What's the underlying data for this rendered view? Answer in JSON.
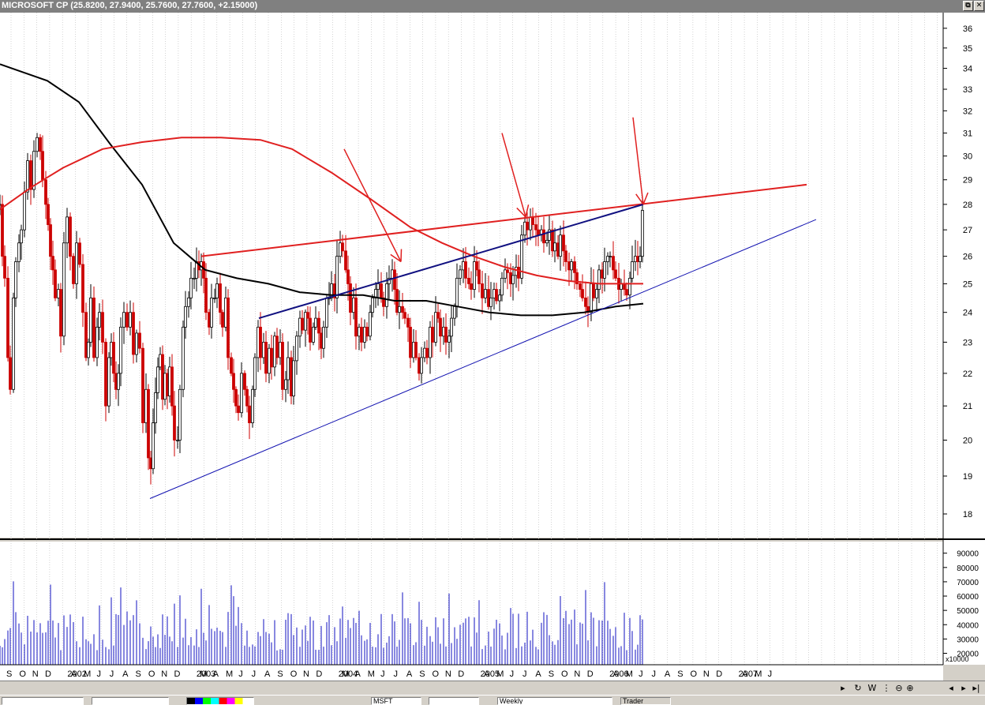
{
  "window": {
    "title": "MICROSOFT CP (25.8200, 27.9400, 25.7600, 27.7600, +2.15000)",
    "restore_label": "⧉",
    "close_label": "✕"
  },
  "colors": {
    "background": "#ffffff",
    "frame": "#d4d0c8",
    "candle": "#000000",
    "down_candle": "#cc0000",
    "ma_black": "#000000",
    "ma_red": "#e02020",
    "trend_blue": "#1010b0",
    "trend_red": "#e02020",
    "volume": "#1010c0"
  },
  "chart_data": {
    "type": "candlestick",
    "price_axis": {
      "scale": "log",
      "ylim": [
        17.5,
        36.4
      ],
      "ticks": [
        18,
        19,
        20,
        21,
        22,
        23,
        24,
        25,
        26,
        27,
        28,
        29,
        30,
        31,
        32,
        33,
        34,
        35,
        36
      ]
    },
    "volume_axis": {
      "ylim": [
        12000,
        97000
      ],
      "ticks": [
        20000,
        30000,
        40000,
        50000,
        60000,
        70000,
        80000,
        90000
      ],
      "tick_labels": [
        "20000",
        "30000",
        "40000",
        "50000",
        "60000",
        "70000",
        "80000",
        "90000"
      ],
      "unit_label": "x10000"
    },
    "x_axis": {
      "labels": [
        "S",
        "O",
        "N",
        "D",
        "2002",
        "A",
        "M",
        "J",
        "J",
        "A",
        "S",
        "O",
        "N",
        "D",
        "2003",
        "M",
        "A",
        "M",
        "J",
        "J",
        "A",
        "S",
        "O",
        "N",
        "D",
        "2004",
        "M",
        "A",
        "M",
        "J",
        "J",
        "A",
        "S",
        "O",
        "N",
        "D",
        "2005",
        "A",
        "M",
        "J",
        "J",
        "A",
        "S",
        "O",
        "N",
        "D",
        "2006",
        "A",
        "M",
        "J",
        "J",
        "A",
        "S",
        "O",
        "N",
        "D",
        "2007",
        "A",
        "M",
        "J"
      ]
    },
    "price_anchors": [
      [
        0,
        28
      ],
      [
        3,
        26
      ],
      [
        6,
        25.2
      ],
      [
        10,
        22.5
      ],
      [
        13,
        21.5
      ],
      [
        17,
        24.5
      ],
      [
        20,
        25.8
      ],
      [
        24,
        26.5
      ],
      [
        27,
        27
      ],
      [
        31,
        28.5
      ],
      [
        35,
        29.8
      ],
      [
        39,
        28.6
      ],
      [
        43,
        30.2
      ],
      [
        47,
        30.8
      ],
      [
        51,
        30.2
      ],
      [
        54,
        29
      ],
      [
        58,
        28
      ],
      [
        61,
        27.2
      ],
      [
        64,
        26
      ],
      [
        67,
        25.5
      ],
      [
        70,
        24.5
      ],
      [
        74,
        24.8
      ],
      [
        77,
        23.2
      ],
      [
        81,
        26.5
      ],
      [
        85,
        27.5
      ],
      [
        89,
        26
      ],
      [
        93,
        25
      ],
      [
        97,
        26.5
      ],
      [
        101,
        25.7
      ],
      [
        105,
        24
      ],
      [
        109,
        22.5
      ],
      [
        112,
        23
      ],
      [
        115,
        24.5
      ],
      [
        119,
        22.5
      ],
      [
        123,
        23.5
      ],
      [
        126,
        24
      ],
      [
        130,
        23
      ],
      [
        134,
        21
      ],
      [
        138,
        22.5
      ],
      [
        141,
        23
      ],
      [
        144,
        22
      ],
      [
        147,
        21.5
      ],
      [
        150,
        22
      ],
      [
        153,
        23.5
      ],
      [
        157,
        24
      ],
      [
        161,
        23.5
      ],
      [
        165,
        24
      ],
      [
        169,
        22.6
      ],
      [
        173,
        23.3
      ],
      [
        177,
        22.8
      ],
      [
        181,
        20.5
      ],
      [
        185,
        21.5
      ],
      [
        188,
        19.5
      ],
      [
        191,
        19.2
      ],
      [
        194,
        20.5
      ],
      [
        197,
        21.4
      ],
      [
        200,
        22.2
      ],
      [
        203,
        22.6
      ],
      [
        206,
        21.2
      ],
      [
        209,
        22
      ],
      [
        212,
        21.3
      ],
      [
        215,
        22.2
      ],
      [
        218,
        21
      ],
      [
        221,
        20
      ],
      [
        225,
        20
      ],
      [
        228,
        21.5
      ],
      [
        232,
        23.5
      ],
      [
        235,
        24.2
      ],
      [
        239,
        24.5
      ],
      [
        242,
        25.2
      ],
      [
        246,
        25.2
      ],
      [
        249,
        25.8
      ],
      [
        252,
        25.5
      ],
      [
        255,
        25.8
      ],
      [
        258,
        25.2
      ],
      [
        261,
        24
      ],
      [
        265,
        23.5
      ],
      [
        268,
        24.5
      ],
      [
        272,
        24.5
      ],
      [
        275,
        25
      ],
      [
        279,
        24
      ],
      [
        282,
        23.5
      ],
      [
        286,
        24.5
      ],
      [
        289,
        22.5
      ],
      [
        293,
        22
      ],
      [
        296,
        21.5
      ],
      [
        299,
        21
      ],
      [
        302,
        20.8
      ],
      [
        306,
        22
      ],
      [
        310,
        21.5
      ],
      [
        313,
        21
      ],
      [
        316,
        20.5
      ],
      [
        320,
        21.5
      ],
      [
        323,
        22.5
      ],
      [
        327,
        23.5
      ],
      [
        330,
        22.5
      ],
      [
        334,
        23
      ],
      [
        337,
        22
      ],
      [
        341,
        22.8
      ],
      [
        344,
        22.2
      ],
      [
        348,
        23.2
      ],
      [
        351,
        22.5
      ],
      [
        355,
        23
      ],
      [
        358,
        21.5
      ],
      [
        362,
        21.8
      ],
      [
        365,
        22.5
      ],
      [
        369,
        21.3
      ],
      [
        372,
        22.4
      ],
      [
        376,
        23.2
      ],
      [
        380,
        23.8
      ],
      [
        383,
        23.4
      ],
      [
        387,
        24
      ],
      [
        390,
        23.8
      ],
      [
        393,
        23
      ],
      [
        397,
        23.5
      ],
      [
        400,
        23.8
      ],
      [
        404,
        23.3
      ],
      [
        407,
        22.8
      ],
      [
        410,
        23.5
      ],
      [
        414,
        24.5
      ],
      [
        417,
        24.5
      ],
      [
        420,
        25
      ],
      [
        424,
        24.5
      ],
      [
        427,
        26
      ],
      [
        431,
        26.5
      ],
      [
        434,
        26.2
      ],
      [
        438,
        25.5
      ],
      [
        441,
        25
      ],
      [
        444,
        24
      ],
      [
        448,
        24.5
      ],
      [
        451,
        23.2
      ],
      [
        455,
        23.5
      ],
      [
        458,
        23
      ],
      [
        462,
        23.5
      ],
      [
        465,
        23.2
      ],
      [
        469,
        24
      ],
      [
        472,
        24.5
      ],
      [
        476,
        24.8
      ],
      [
        479,
        25
      ],
      [
        483,
        24.5
      ],
      [
        486,
        24.2
      ],
      [
        490,
        25
      ],
      [
        493,
        25.2
      ],
      [
        497,
        25.5
      ],
      [
        500,
        24.8
      ],
      [
        503,
        24
      ],
      [
        506,
        24.2
      ],
      [
        510,
        24
      ],
      [
        513,
        23.8
      ],
      [
        517,
        23.5
      ],
      [
        520,
        22.5
      ],
      [
        524,
        23
      ],
      [
        527,
        22.5
      ],
      [
        531,
        22
      ],
      [
        534,
        22.5
      ],
      [
        538,
        22.8
      ],
      [
        541,
        22.5
      ],
      [
        545,
        23.5
      ],
      [
        548,
        23
      ],
      [
        552,
        24
      ],
      [
        555,
        23.8
      ],
      [
        558,
        23.2
      ],
      [
        562,
        23.5
      ],
      [
        565,
        23
      ],
      [
        569,
        23.2
      ],
      [
        572,
        23.8
      ],
      [
        576,
        24.2
      ],
      [
        579,
        25.2
      ],
      [
        583,
        25.5
      ],
      [
        587,
        25.8
      ],
      [
        590,
        25.2
      ],
      [
        594,
        25
      ],
      [
        597,
        24.8
      ],
      [
        601,
        25.8
      ],
      [
        604,
        25.5
      ],
      [
        607,
        25
      ],
      [
        611,
        24.5
      ],
      [
        615,
        24.8
      ],
      [
        619,
        24.2
      ],
      [
        622,
        24.5
      ],
      [
        626,
        24.8
      ],
      [
        629,
        24.4
      ],
      [
        633,
        24.6
      ],
      [
        636,
        25.2
      ],
      [
        640,
        25.5
      ],
      [
        643,
        25.4
      ],
      [
        647,
        25
      ],
      [
        650,
        25.3
      ],
      [
        654,
        25.6
      ],
      [
        657,
        25.2
      ],
      [
        661,
        26.8
      ],
      [
        665,
        27.3
      ],
      [
        668,
        27
      ],
      [
        672,
        27.5
      ],
      [
        675,
        27.2
      ],
      [
        679,
        27
      ],
      [
        682,
        26.8
      ],
      [
        686,
        27
      ],
      [
        689,
        26.5
      ],
      [
        693,
        26.6
      ],
      [
        696,
        27
      ],
      [
        700,
        26.2
      ],
      [
        703,
        26.5
      ],
      [
        707,
        26
      ],
      [
        710,
        26.8
      ],
      [
        714,
        26.2
      ],
      [
        717,
        25.8
      ],
      [
        721,
        25.5
      ],
      [
        724,
        25.8
      ],
      [
        728,
        25.4
      ],
      [
        731,
        25
      ],
      [
        735,
        24.8
      ],
      [
        738,
        24.5
      ],
      [
        742,
        24.2
      ],
      [
        745,
        24
      ],
      [
        749,
        25
      ],
      [
        752,
        24.5
      ],
      [
        756,
        24.8
      ],
      [
        759,
        25.5
      ],
      [
        763,
        25.2
      ],
      [
        766,
        25.8
      ],
      [
        770,
        26
      ],
      [
        773,
        26
      ],
      [
        777,
        25.5
      ],
      [
        780,
        25.2
      ],
      [
        784,
        24.8
      ],
      [
        787,
        25
      ],
      [
        791,
        24.8
      ],
      [
        794,
        24.6
      ],
      [
        798,
        25.2
      ],
      [
        801,
        25.8
      ],
      [
        805,
        26
      ],
      [
        808,
        25.8
      ],
      [
        811,
        26
      ],
      [
        814,
        27.76
      ]
    ],
    "moving_averages": [
      {
        "color": "#000000",
        "points": [
          [
            0,
            34.2
          ],
          [
            30,
            33.8
          ],
          [
            60,
            33.4
          ],
          [
            100,
            32.4
          ],
          [
            140,
            30.5
          ],
          [
            180,
            28.8
          ],
          [
            220,
            26.5
          ],
          [
            260,
            25.5
          ],
          [
            300,
            25.2
          ],
          [
            340,
            25
          ],
          [
            380,
            24.7
          ],
          [
            420,
            24.6
          ],
          [
            460,
            24.6
          ],
          [
            500,
            24.4
          ],
          [
            540,
            24.4
          ],
          [
            580,
            24.2
          ],
          [
            620,
            24
          ],
          [
            660,
            23.9
          ],
          [
            700,
            23.9
          ],
          [
            740,
            24
          ],
          [
            780,
            24.2
          ],
          [
            815,
            24.3
          ]
        ]
      },
      {
        "color": "#e02020",
        "points": [
          [
            0,
            27.8
          ],
          [
            40,
            28.7
          ],
          [
            80,
            29.5
          ],
          [
            130,
            30.3
          ],
          [
            180,
            30.6
          ],
          [
            230,
            30.8
          ],
          [
            280,
            30.8
          ],
          [
            330,
            30.7
          ],
          [
            370,
            30.3
          ],
          [
            420,
            29.3
          ],
          [
            470,
            28.2
          ],
          [
            520,
            27.1
          ],
          [
            560,
            26.5
          ],
          [
            600,
            26
          ],
          [
            640,
            25.6
          ],
          [
            680,
            25.3
          ],
          [
            720,
            25.1
          ],
          [
            760,
            25
          ],
          [
            790,
            25
          ],
          [
            815,
            25
          ]
        ]
      }
    ],
    "trend_lines": [
      {
        "color": "#e02020",
        "width": 2,
        "from": [
          255,
          26
        ],
        "to": [
          1022,
          28.8
        ]
      },
      {
        "color": "#1010b0",
        "width": 1,
        "from": [
          190,
          18.4
        ],
        "to": [
          1034,
          27.4
        ]
      },
      {
        "color": "#101080",
        "width": 2,
        "from": [
          328,
          23.8
        ],
        "to": [
          815,
          28
        ]
      }
    ],
    "arrows": [
      {
        "from": [
          436,
          30.3
        ],
        "to": [
          508,
          25.8
        ]
      },
      {
        "from": [
          636,
          31
        ],
        "to": [
          666,
          27.5
        ]
      },
      {
        "from": [
          802,
          31.7
        ],
        "to": [
          815,
          28
        ]
      }
    ],
    "volume_seed": 7
  },
  "statusbar": {
    "symbol": "MSFT",
    "view": "Weekly",
    "button": "Trader"
  }
}
